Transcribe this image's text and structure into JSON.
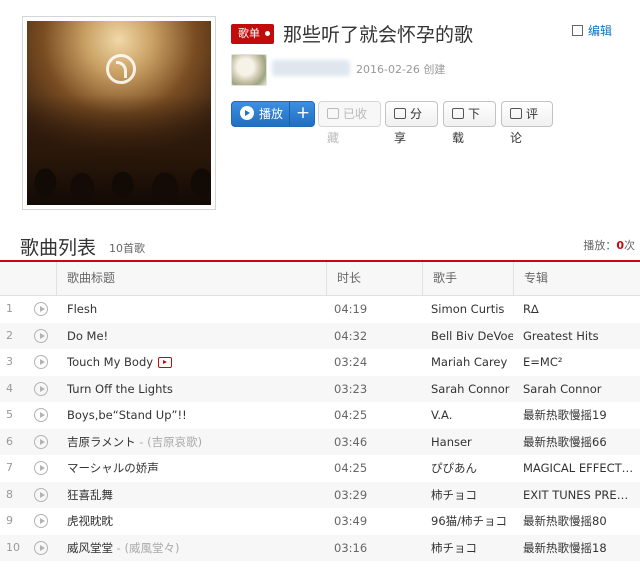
{
  "playlist": {
    "tag": "歌单",
    "title": "那些听了就会怀孕的歌",
    "edit_label": "编辑",
    "created": "2016-02-26 创建"
  },
  "actions": {
    "play": "播放",
    "add": "+",
    "collect": "已收藏",
    "share": "分享",
    "download": "下载",
    "comment": "评论"
  },
  "songlist": {
    "title": "歌曲列表",
    "count": "10首歌",
    "plays_label": "播放：",
    "plays_value": "0",
    "plays_unit": "次",
    "columns": [
      "歌曲标题",
      "时长",
      "歌手",
      "专辑"
    ]
  },
  "songs": [
    {
      "index": "1",
      "title": "Flesh",
      "alias": "",
      "mv": false,
      "duration": "04:19",
      "artist": "Simon Curtis",
      "album": "R∆"
    },
    {
      "index": "2",
      "title": "Do Me!",
      "alias": "",
      "mv": false,
      "duration": "04:32",
      "artist": "Bell Biv DeVoe",
      "album": "Greatest Hits"
    },
    {
      "index": "3",
      "title": "Touch My Body",
      "alias": "",
      "mv": true,
      "duration": "03:24",
      "artist": "Mariah Carey",
      "album": "E=MC²"
    },
    {
      "index": "4",
      "title": "Turn Off the Lights",
      "alias": "",
      "mv": false,
      "duration": "03:23",
      "artist": "Sarah Connor",
      "album": "Sarah Connor"
    },
    {
      "index": "5",
      "title": "Boys,be“Stand Up”!!",
      "alias": "",
      "mv": false,
      "duration": "04:25",
      "artist": "V.A.",
      "album": "最新热歌慢摇19"
    },
    {
      "index": "6",
      "title": "吉原ラメント",
      "alias": " - (吉原哀歌)",
      "mv": false,
      "duration": "03:46",
      "artist": "Hanser",
      "album": "最新热歌慢摇66"
    },
    {
      "index": "7",
      "title": "マーシャルの娇声",
      "alias": "",
      "mv": false,
      "duration": "04:25",
      "artist": "ぴぴあん",
      "album": "MAGICAL EFFECTOR"
    },
    {
      "index": "8",
      "title": "狂喜乱舞",
      "alias": "",
      "mv": false,
      "duration": "03:29",
      "artist": "柿チョコ",
      "album": "EXIT TUNES PRESENTS"
    },
    {
      "index": "9",
      "title": "虎视眈眈",
      "alias": "",
      "mv": false,
      "duration": "03:49",
      "artist": "96猫/柿チョコ",
      "album": "最新热歌慢摇80"
    },
    {
      "index": "10",
      "title": "威风堂堂",
      "alias": " - (威風堂々)",
      "mv": false,
      "duration": "03:16",
      "artist": "柿チョコ",
      "album": "最新热歌慢摇18"
    }
  ]
}
